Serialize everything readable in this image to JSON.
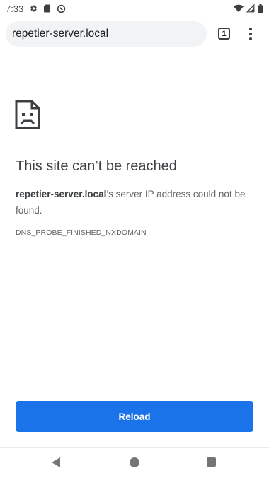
{
  "status_bar": {
    "time": "7:33",
    "left_icons": [
      "settings-icon",
      "sd-card-icon",
      "sync-icon"
    ],
    "right_icons": [
      "wifi-icon",
      "cell-signal-icon",
      "battery-icon"
    ]
  },
  "browser": {
    "url": "repetier-server.local",
    "tab_count": "1",
    "menu_icon": "more-vert-icon"
  },
  "error": {
    "icon": "sad-page-icon",
    "title": "This site can’t be reached",
    "host": "repetier-server.local",
    "message_suffix": "’s server IP address could not be found.",
    "code": "DNS_PROBE_FINISHED_NXDOMAIN",
    "reload_label": "Reload"
  },
  "colors": {
    "accent": "#1a73e8",
    "omnibox_bg": "#f1f3f4",
    "title_text": "#3c4043",
    "body_text": "#5f6368"
  },
  "nav_bar": {
    "icons": [
      "back-icon",
      "home-icon",
      "recents-icon"
    ]
  }
}
